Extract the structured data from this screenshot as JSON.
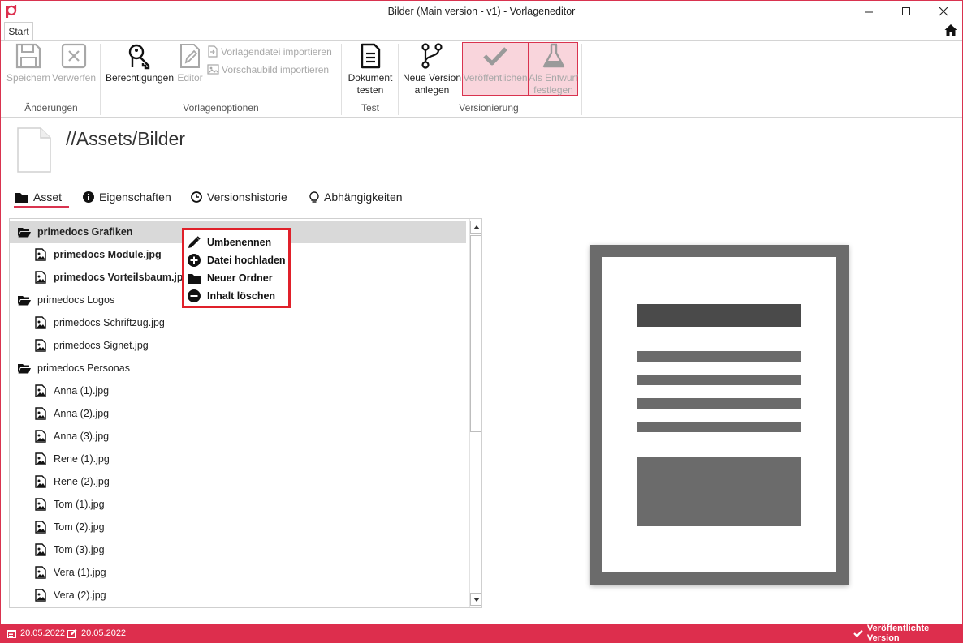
{
  "window": {
    "title": "Bilder (Main version - v1) - Vorlageneditor"
  },
  "ribbon": {
    "tab_start": "Start",
    "groups": {
      "changes": "Änderungen",
      "template_options": "Vorlagenoptionen",
      "test": "Test",
      "versioning": "Versionierung"
    },
    "save": "Speichern",
    "discard": "Verwerfen",
    "permissions": "Berechtigungen",
    "editor": "Editor",
    "import_template": "Vorlagendatei importieren",
    "import_preview": "Vorschaubild importieren",
    "test_document_1": "Dokument",
    "test_document_2": "testen",
    "new_version_1": "Neue Version",
    "new_version_2": "anlegen",
    "publish": "Veröffentlichen",
    "draft_1": "Als Entwurf",
    "draft_2": "festlegen"
  },
  "asset": {
    "path": "//Assets/Bilder"
  },
  "tabs": [
    {
      "label": "Asset"
    },
    {
      "label": "Eigenschaften"
    },
    {
      "label": "Versionshistorie"
    },
    {
      "label": "Abhängigkeiten"
    }
  ],
  "tree": [
    {
      "label": "primedocs Grafiken",
      "type": "folder"
    },
    {
      "label": "primedocs Module.jpg",
      "type": "file"
    },
    {
      "label": "primedocs Vorteilsbaum.jpg",
      "type": "file"
    },
    {
      "label": "primedocs Logos",
      "type": "folder"
    },
    {
      "label": "primedocs Schriftzug.jpg",
      "type": "file"
    },
    {
      "label": "primedocs Signet.jpg",
      "type": "file"
    },
    {
      "label": "primedocs Personas",
      "type": "folder"
    },
    {
      "label": "Anna (1).jpg",
      "type": "file"
    },
    {
      "label": "Anna (2).jpg",
      "type": "file"
    },
    {
      "label": "Anna (3).jpg",
      "type": "file"
    },
    {
      "label": "Rene (1).jpg",
      "type": "file"
    },
    {
      "label": "Rene (2).jpg",
      "type": "file"
    },
    {
      "label": "Tom (1).jpg",
      "type": "file"
    },
    {
      "label": "Tom (2).jpg",
      "type": "file"
    },
    {
      "label": "Tom (3).jpg",
      "type": "file"
    },
    {
      "label": "Vera (1).jpg",
      "type": "file"
    },
    {
      "label": "Vera (2).jpg",
      "type": "file"
    }
  ],
  "context_menu": {
    "rename": "Umbenennen",
    "upload": "Datei hochladen",
    "new_folder": "Neuer Ordner",
    "delete": "Inhalt löschen"
  },
  "status": {
    "created": "20.05.2022",
    "modified": "20.05.2022",
    "state": "Veröffentlichte Version"
  },
  "colors": {
    "accent": "#dd2e4d",
    "highlight": "#f9d5dc",
    "preview_gray": "#6b6b6b"
  }
}
